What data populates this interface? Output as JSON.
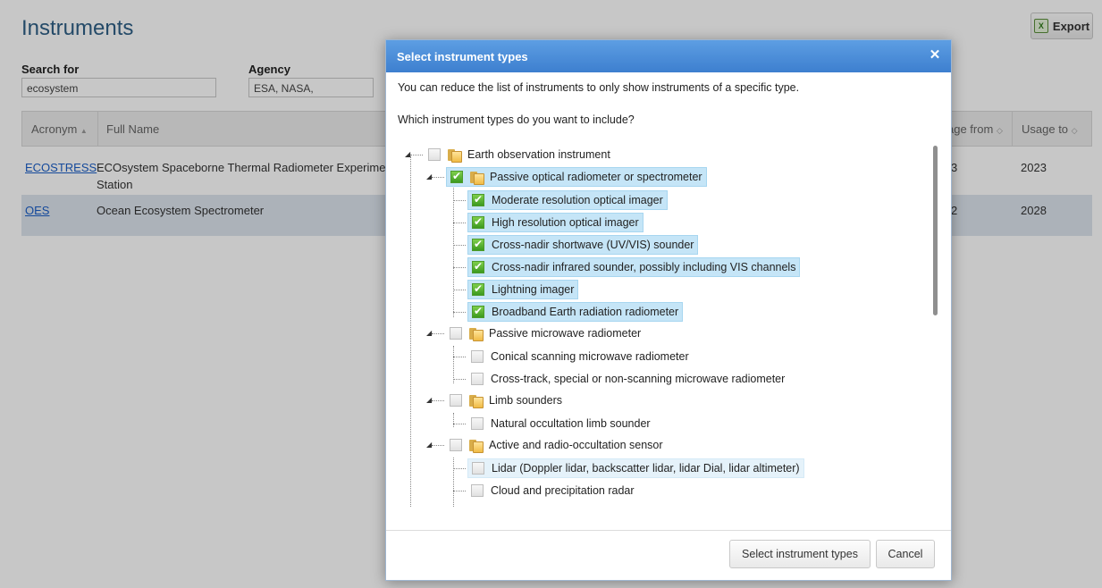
{
  "page": {
    "title": "Instruments",
    "export_label": "Export",
    "export_icon": "excel-icon"
  },
  "filters": {
    "search_label": "Search for",
    "search_value": "ecosystem",
    "agency_label": "Agency",
    "agency_value": "ESA, NASA,"
  },
  "table": {
    "columns": [
      "Acronym",
      "Full Name",
      "age from",
      "Usage to"
    ],
    "sort_indicators": [
      "▲",
      "◇",
      "◇"
    ],
    "rows": [
      {
        "acronym": "ECOSTRESS",
        "full_name": "ECOsystem Spaceborne Thermal Radiometer Experimen",
        "full_name_line2": "Station",
        "usage_from": "3",
        "usage_to": "2023"
      },
      {
        "acronym": "OES",
        "full_name": "Ocean Ecosystem Spectrometer",
        "usage_from": "2",
        "usage_to": "2028"
      }
    ]
  },
  "modal": {
    "title": "Select instrument types",
    "close_icon": "close-icon",
    "intro": "You can reduce the list of instruments to only show instruments of a specific type.",
    "question": "Which instrument types do you want to include?",
    "tree": {
      "root": "Earth observation instrument",
      "groups": [
        {
          "label": "Passive optical radiometer or spectrometer",
          "checked": true,
          "children": [
            {
              "label": "Moderate resolution optical imager",
              "checked": true
            },
            {
              "label": "High resolution optical imager",
              "checked": true
            },
            {
              "label": "Cross-nadir shortwave (UV/VIS) sounder",
              "checked": true
            },
            {
              "label": "Cross-nadir infrared sounder, possibly including VIS channels",
              "checked": true
            },
            {
              "label": "Lightning imager",
              "checked": true
            },
            {
              "label": "Broadband Earth radiation radiometer",
              "checked": true
            }
          ]
        },
        {
          "label": "Passive microwave radiometer",
          "checked": false,
          "children": [
            {
              "label": "Conical scanning microwave radiometer",
              "checked": false
            },
            {
              "label": "Cross-track, special or non-scanning microwave radiometer",
              "checked": false
            }
          ]
        },
        {
          "label": "Limb sounders",
          "checked": false,
          "children": [
            {
              "label": "Natural occultation limb sounder",
              "checked": false
            }
          ]
        },
        {
          "label": "Active and radio-occultation sensor",
          "checked": false,
          "children": [
            {
              "label": "Lidar (Doppler lidar, backscatter lidar, lidar Dial, lidar altimeter)",
              "checked": false
            },
            {
              "label": "Cloud and precipitation radar",
              "checked": false
            }
          ]
        }
      ]
    },
    "select_button": "Select instrument types",
    "cancel_button": "Cancel"
  },
  "colors": {
    "header_blue": "#3d7fcf",
    "selected_row": "#c5e5f7",
    "link": "#1a5ec7",
    "check_green": "#3c9a1f"
  }
}
